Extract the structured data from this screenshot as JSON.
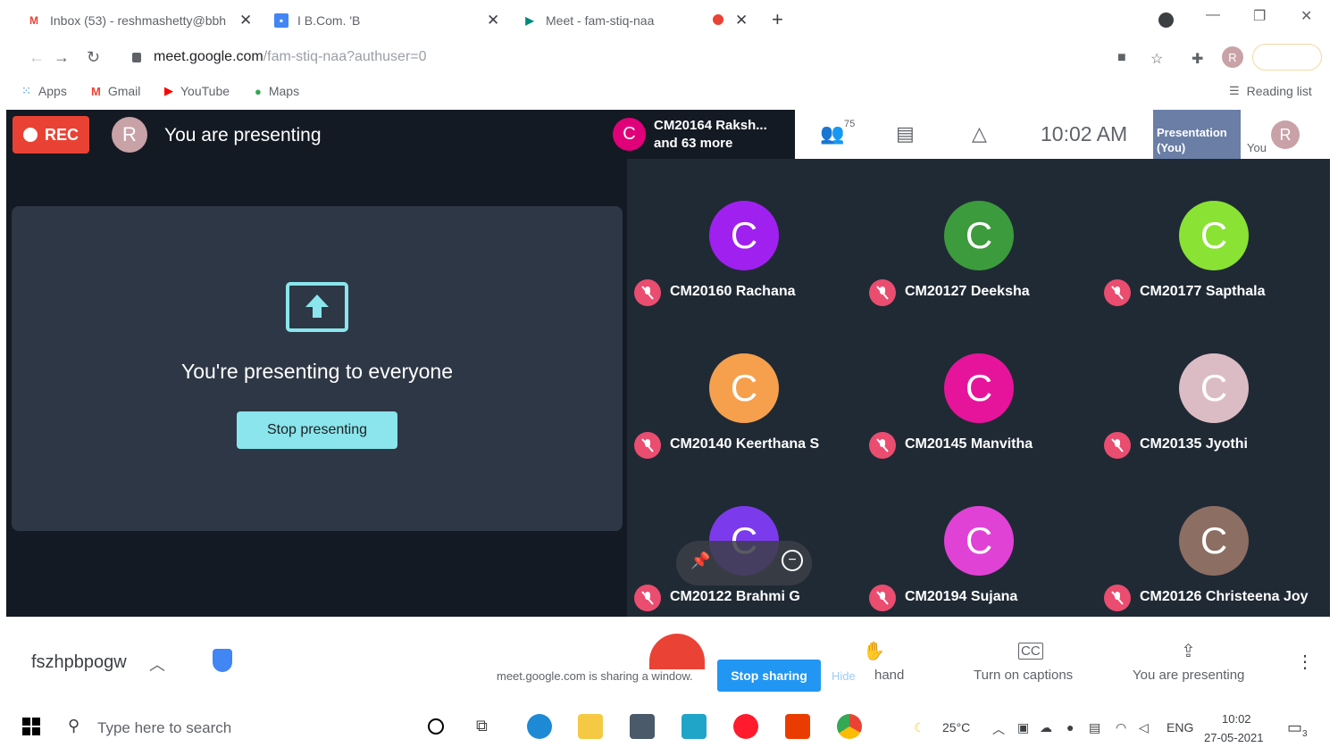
{
  "browser": {
    "tabs": [
      {
        "title": "Inbox (53) - reshmashetty@bbh",
        "close": "✕"
      },
      {
        "title": "I B.Com. 'B",
        "close": "✕"
      },
      {
        "title": "Meet - fam-stiq-naa",
        "close": "✕"
      }
    ],
    "new_tab": "+",
    "url_host": "meet.google.com",
    "url_path": "/fam-stiq-naa?authuser=0",
    "profile_initial": "R",
    "bookmarks": [
      "Apps",
      "Gmail",
      "YouTube",
      "Maps"
    ],
    "reading_list": "Reading list"
  },
  "meet": {
    "rec_label": "REC",
    "presenter_initial": "R",
    "presenting_title": "You are presenting",
    "present_message": "You're presenting to everyone",
    "stop_presenting": "Stop presenting",
    "chip": {
      "initial": "C",
      "line1": "CM20164 Raksh...",
      "line2": "and 63 more"
    },
    "participant_count": "75",
    "clock": "10:02  AM",
    "thumb_label": "Presentation (You)",
    "you_label": "You",
    "you_initial": "R",
    "tiles": [
      {
        "initial": "C",
        "name": "CM20160 Rachana",
        "color": "#a020f0"
      },
      {
        "initial": "C",
        "name": "CM20127 Deeksha",
        "color": "#3c9b3c"
      },
      {
        "initial": "C",
        "name": "CM20177 Sapthala",
        "color": "#8ae234"
      },
      {
        "initial": "C",
        "name": "CM20140 Keerthana S",
        "color": "#f6a04d"
      },
      {
        "initial": "C",
        "name": "CM20145 Manvitha",
        "color": "#e6149b"
      },
      {
        "initial": "C",
        "name": "CM20135 Jyothi",
        "color": "#dcbcc4"
      },
      {
        "initial": "C",
        "name": "CM20122 Brahmi G",
        "color": "#7c3aed"
      },
      {
        "initial": "C",
        "name": "CM20194 Sujana",
        "color": "#e142d6"
      },
      {
        "initial": "C",
        "name": "CM20126 Christeena Joy",
        "color": "#8d6e63"
      }
    ]
  },
  "sharebar": {
    "meeting_code": "fszhpbpogw",
    "share_info": "meet.google.com is sharing a window.",
    "stop_sharing": "Stop sharing",
    "hide": "Hide",
    "raise_hand": "hand",
    "captions": "Turn on captions",
    "you_presenting": "You are presenting"
  },
  "taskbar": {
    "search_placeholder": "Type here to search",
    "temperature": "25°C",
    "language": "ENG",
    "time": "10:02",
    "date": "27-05-2021",
    "notifications": "3"
  }
}
